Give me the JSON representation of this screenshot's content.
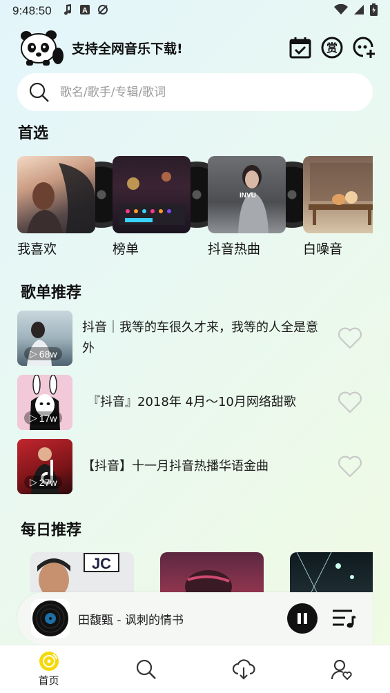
{
  "status_bar": {
    "time": "9:48:50"
  },
  "header": {
    "title": "支持全网音乐下载!"
  },
  "search": {
    "placeholder": "歌名/歌手/专辑/歌词"
  },
  "sections": {
    "featured_title": "首选",
    "playlist_title": "歌单推荐",
    "daily_title": "每日推荐"
  },
  "featured": [
    {
      "label": "我喜欢"
    },
    {
      "label": "榜单"
    },
    {
      "label": "抖音热曲"
    },
    {
      "label": "白噪音"
    }
  ],
  "playlists": [
    {
      "title": "抖音｜我等的车很久才来，我等的人全是意外",
      "plays": "68w"
    },
    {
      "title": "『抖音』2018年 4月～10月网络甜歌",
      "plays": "17w"
    },
    {
      "title": "【抖音】十一月抖音热播华语金曲",
      "plays": "27w"
    }
  ],
  "daily_covers": [
    {
      "text": "JC"
    },
    {
      "text": ""
    },
    {
      "text": ""
    }
  ],
  "player": {
    "track": "田馥甄 - 讽刺的情书",
    "state": "playing"
  },
  "tabs": [
    {
      "label": "首页",
      "icon": "home-disc-icon",
      "active": true
    },
    {
      "label": "",
      "icon": "search-icon",
      "active": false
    },
    {
      "label": "",
      "icon": "cloud-download-icon",
      "active": false
    },
    {
      "label": "",
      "icon": "user-heart-icon",
      "active": false
    }
  ],
  "colors": {
    "accent": "#f5d90a",
    "text": "#111111",
    "heart": "#c8c8c8"
  }
}
